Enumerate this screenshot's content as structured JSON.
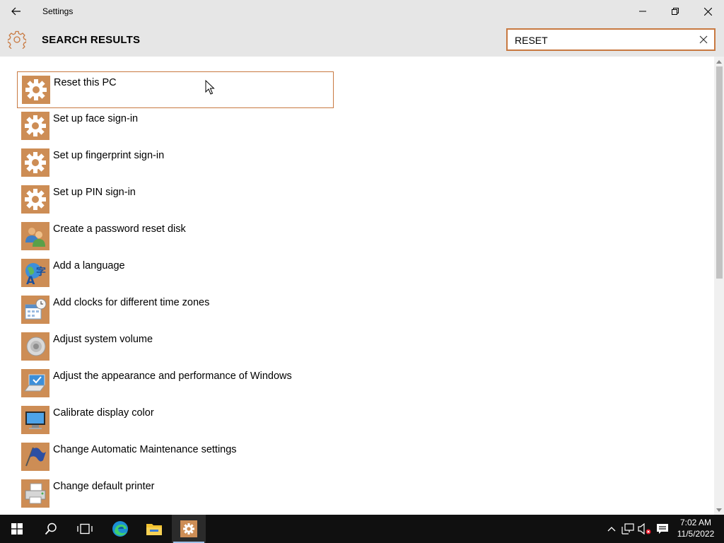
{
  "window": {
    "title": "Settings"
  },
  "header": {
    "title": "SEARCH RESULTS",
    "search_value": "RESET"
  },
  "results": [
    {
      "label": "Reset this PC",
      "icon": "gear-icon",
      "selected": true
    },
    {
      "label": "Set up face sign-in",
      "icon": "gear-icon"
    },
    {
      "label": "Set up fingerprint sign-in",
      "icon": "gear-icon"
    },
    {
      "label": "Set up PIN sign-in",
      "icon": "gear-icon"
    },
    {
      "label": "Create a password reset disk",
      "icon": "user-accounts-icon"
    },
    {
      "label": "Add a language",
      "icon": "language-icon"
    },
    {
      "label": "Add clocks for different time zones",
      "icon": "calendar-clock-icon"
    },
    {
      "label": "Adjust system volume",
      "icon": "speaker-icon"
    },
    {
      "label": "Adjust the appearance and performance of Windows",
      "icon": "laptop-check-icon"
    },
    {
      "label": "Calibrate display color",
      "icon": "monitor-icon"
    },
    {
      "label": "Change Automatic Maintenance settings",
      "icon": "maintenance-flag-icon"
    },
    {
      "label": "Change default printer",
      "icon": "printer-icon"
    }
  ],
  "taskbar": {
    "time": "7:02 AM",
    "date": "11/5/2022"
  },
  "colors": {
    "accent": "#c87941",
    "icon_tile": "#cd8d55",
    "chrome": "#e6e6e6",
    "taskbar": "#101010"
  }
}
